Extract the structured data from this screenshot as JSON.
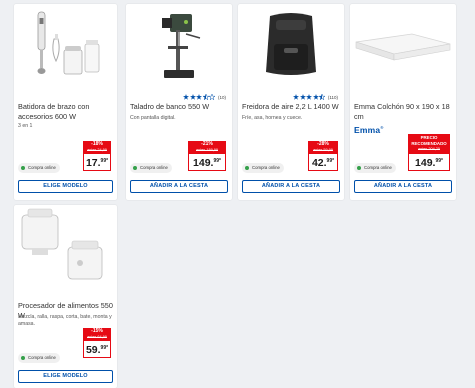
{
  "products": [
    {
      "title": "Batidora de brazo con accesorios 600 W",
      "subtitle": "3 en 1",
      "badge": "Compra online",
      "discount": "-18%",
      "old_price": "antes 24,99",
      "price": "17.",
      "price_decimal": "99",
      "price_suffix": "*",
      "button": "ELIGE MODELO"
    },
    {
      "title": "Taladro de banco 550 W",
      "subtitle": "Con pantalla digital.",
      "rating_stars": 3.5,
      "rating_count": "(10)",
      "badge": "Compra online",
      "discount": "-21%",
      "old_price": "antes 189,99",
      "price": "149.",
      "price_decimal": "99",
      "price_suffix": "*",
      "button": "AÑADIR A LA CESTA"
    },
    {
      "title": "Freidora de aire 2,2 L 1400 W",
      "subtitle": "Fríe, asa, hornea y cuece.",
      "rating_stars": 4.5,
      "rating_count": "(110)",
      "badge": "Compra online",
      "discount": "-28%",
      "old_price": "antes 59,99",
      "price": "42.",
      "price_decimal": "99",
      "price_suffix": "*",
      "button": "AÑADIR A LA CESTA"
    },
    {
      "title": "Emma Colchón 90 x 190 x 18 cm",
      "brand": "Emma",
      "brand_mark": "®",
      "badge": "Compra online",
      "discount": "PRECIO RECOMENDADO",
      "old_price": "antes 204,25",
      "price": "149.",
      "price_decimal": "99",
      "price_suffix": "*",
      "button": "AÑADIR A LA CESTA"
    },
    {
      "title": "Procesador de alimentos 550 W",
      "subtitle": "Mezcla, ralla, raspa, corta, bate, monta y amasa.",
      "badge": "Compra online",
      "discount": "-15%",
      "old_price": "antes 64,99",
      "price": "59.",
      "price_decimal": "99",
      "price_suffix": "*",
      "button": "ELIGE MODELO"
    }
  ],
  "colors": {
    "accent": "#0050aa",
    "sale": "#e60a14",
    "online": "#35a04a"
  }
}
